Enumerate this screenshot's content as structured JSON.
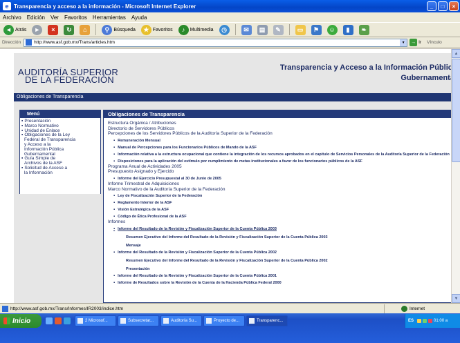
{
  "window": {
    "title": "Transparencia y acceso a la información - Microsoft Internet Explorer"
  },
  "menubar": [
    "Archivo",
    "Edición",
    "Ver",
    "Favoritos",
    "Herramientas",
    "Ayuda"
  ],
  "toolbar": {
    "back": "Atrás",
    "search": "Búsqueda",
    "favorites": "Favoritos",
    "multimedia": "Multimedia"
  },
  "address": {
    "label": "Dirección",
    "url": "http://www.asf.gob.mx/Trans/articles.htm",
    "go": "Ir",
    "links": "Vínculo"
  },
  "site": {
    "logo_line1": "AUDITORÍA SUPERIOR",
    "logo_line2": "DE LA FEDERACIÓN",
    "title_line1": "Transparencia y Acceso a la Información Pública",
    "title_line2": "Gubernamental",
    "subbar": "Obligaciones de Transparencia"
  },
  "sidebar": {
    "heading": "Menú",
    "items": [
      {
        "label": "Presentación",
        "bullet": true
      },
      {
        "label": "Marco Normativo",
        "bullet": true
      },
      {
        "label": "Unidad de Enlace",
        "bullet": true
      },
      {
        "label": "Obligaciones de la Ley",
        "bullet": true
      },
      {
        "label": "Federal de Transparencia",
        "bullet": false
      },
      {
        "label": "y Acceso a la",
        "bullet": false
      },
      {
        "label": "Información Pública",
        "bullet": false
      },
      {
        "label": "Gubernamental",
        "bullet": false
      },
      {
        "label": "Guía Simple de",
        "bullet": true
      },
      {
        "label": "Archivos de la ASF",
        "bullet": false
      },
      {
        "label": "Solicitud de Acceso a",
        "bullet": true
      },
      {
        "label": "la Información",
        "bullet": false
      }
    ]
  },
  "content": {
    "heading": "Obligaciones de Transparencia",
    "lines": [
      {
        "t": "h",
        "text": "Estructura Orgánica / Atribuciones"
      },
      {
        "t": "h",
        "text": "Directorio de Servidores Públicos"
      },
      {
        "t": "h",
        "text": "Percepciones de los Servidores Públicos de la Auditoría Superior de la Federación"
      },
      {
        "t": "b",
        "text": "Remuneración Mensual"
      },
      {
        "t": "b",
        "text": "Manual de Percepciones para los Funcionarios Públicos de Mando de la ASF"
      },
      {
        "t": "b",
        "text": "Información relativa a la estructura ocupacional que contiene la integración de los recursos aprobados en el capítulo de Servicios Personales de la Auditoría Superior de la Federación"
      },
      {
        "t": "b",
        "text": "Disposiciones para la aplicación del estímulo por cumplimiento de metas institucionales a favor de los funcionarios públicos de la ASF"
      },
      {
        "t": "h",
        "text": "Programa Anual de Actividades 2005"
      },
      {
        "t": "h",
        "text": "Presupuesto Asignado y Ejercido"
      },
      {
        "t": "b",
        "text": "Informe del Ejercicio Presupuestal al 30 de Junio de 2005"
      },
      {
        "t": "h",
        "text": "Informe Trimestral de Adquisiciones"
      },
      {
        "t": "h",
        "text": "Marco Normativo de la Auditoría Superior de la Federación"
      },
      {
        "t": "b",
        "text": "Ley de Fiscalización Superior de la Federación"
      },
      {
        "t": "b",
        "text": "Reglamento Interior de la ASF"
      },
      {
        "t": "b",
        "text": "Visión Estratégica de la ASF"
      },
      {
        "t": "b",
        "text": "Código de Ética Profesional de la ASF"
      },
      {
        "t": "h",
        "text": "Informes"
      },
      {
        "t": "bl",
        "text": "Informe del Resultado de la Revisión y Fiscalización Superior de la Cuenta Pública 2003"
      },
      {
        "t": "s",
        "text": "Resumen Ejecutivo del Informe del Resultado de la Revisión y Fiscalización Superior de la Cuenta Pública 2003"
      },
      {
        "t": "s",
        "text": "Mensaje"
      },
      {
        "t": "b",
        "text": "Informe del Resultado de la Revisión y Fiscalización Superior de la Cuenta Pública 2002"
      },
      {
        "t": "s",
        "text": "Resumen Ejecutivo del Informe del Resultado de la Revisión y Fiscalización Superior de la Cuenta Pública 2002"
      },
      {
        "t": "s",
        "text": "Presentación"
      },
      {
        "t": "b",
        "text": "Informe del Resultado de la Revisión y Fiscalización Superior de la Cuenta Pública 2001"
      },
      {
        "t": "b",
        "text": "Informe de Resultados sobre la Revisión de la Cuenta de la Hacienda Pública Federal 2000"
      }
    ]
  },
  "statusbar": {
    "url": "http://www.asf.gob.mx/Trans/Informes/IR2003/indice.htm",
    "zone": "Internet"
  },
  "taskbar": {
    "start": "Inicio",
    "tasks": [
      "2 Microsof...",
      "Subsecretar...",
      "Auditoría Su...",
      "Proyecto de...",
      "Transparenc..."
    ],
    "lang": "ES",
    "clock": "01:00 a"
  },
  "colors": {
    "accent": "#1b2a63",
    "nav_dark": "#243a7a",
    "xp_blue": "#0445c7"
  }
}
